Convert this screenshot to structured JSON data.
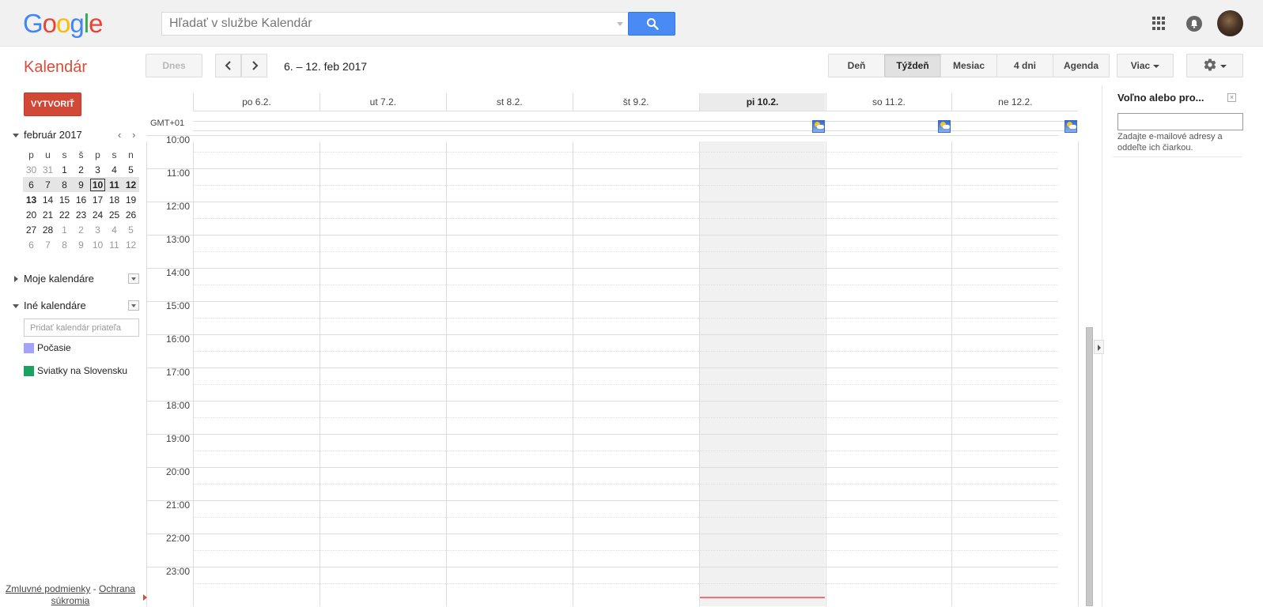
{
  "header": {
    "logo": [
      {
        "letter": "G",
        "color": "#4285f4"
      },
      {
        "letter": "o",
        "color": "#ea4335"
      },
      {
        "letter": "o",
        "color": "#fbbc05"
      },
      {
        "letter": "g",
        "color": "#4285f4"
      },
      {
        "letter": "l",
        "color": "#34a853"
      },
      {
        "letter": "e",
        "color": "#ea4335"
      }
    ],
    "search_placeholder": "Hľadať v službe Kalendár"
  },
  "toolbar": {
    "app_name": "Kalendár",
    "today_label": "Dnes",
    "date_range": "6. – 12. feb 2017",
    "views": [
      "Deň",
      "Týždeň",
      "Mesiac",
      "4 dni",
      "Agenda"
    ],
    "active_view": "Týždeň",
    "more_label": "Viac"
  },
  "sidebar": {
    "create_label": "VYTVORIŤ",
    "mini_calendar": {
      "title": "február 2017",
      "prev": "‹",
      "next": "›",
      "weekdays": [
        "p",
        "u",
        "s",
        "š",
        "p",
        "s",
        "n"
      ],
      "weeks": [
        [
          "30",
          "31",
          "1",
          "2",
          "3",
          "4",
          "5"
        ],
        [
          "6",
          "7",
          "8",
          "9",
          "10",
          "11",
          "12"
        ],
        [
          "13",
          "14",
          "15",
          "16",
          "17",
          "18",
          "19"
        ],
        [
          "20",
          "21",
          "22",
          "23",
          "24",
          "25",
          "26"
        ],
        [
          "27",
          "28",
          "1",
          "2",
          "3",
          "4",
          "5"
        ],
        [
          "6",
          "7",
          "8",
          "9",
          "10",
          "11",
          "12"
        ]
      ]
    },
    "my_calendars_label": "Moje kalendáre",
    "other_calendars_label": "Iné kalendáre",
    "add_friend_placeholder": "Pridať kalendár priateľa",
    "calendars": [
      {
        "name": "Počasie",
        "color": "#a4a4f6"
      },
      {
        "name": "Sviatky na Slovensku",
        "color": "#1aa261"
      }
    ],
    "footer": {
      "terms": "Zmluvné podmienky",
      "sep": " - ",
      "privacy": "Ochrana súkromia"
    }
  },
  "week": {
    "timezone": "GMT+01",
    "days": [
      {
        "label": "po 6.2.",
        "today": false
      },
      {
        "label": "ut 7.2.",
        "today": false
      },
      {
        "label": "st 8.2.",
        "today": false
      },
      {
        "label": "št 9.2.",
        "today": false
      },
      {
        "label": "pi 10.2.",
        "today": true
      },
      {
        "label": "so 11.2.",
        "today": false
      },
      {
        "label": "ne 12.2.",
        "today": false
      }
    ],
    "hours": [
      "10:00",
      "11:00",
      "12:00",
      "13:00",
      "14:00",
      "15:00",
      "16:00",
      "17:00",
      "18:00",
      "19:00",
      "20:00",
      "21:00",
      "22:00",
      "23:00"
    ]
  },
  "right_panel": {
    "title": "Voľno alebo pro...",
    "close": "×",
    "hint": "Zadajte e-mailové adresy a oddeľte ich čiarkou."
  }
}
